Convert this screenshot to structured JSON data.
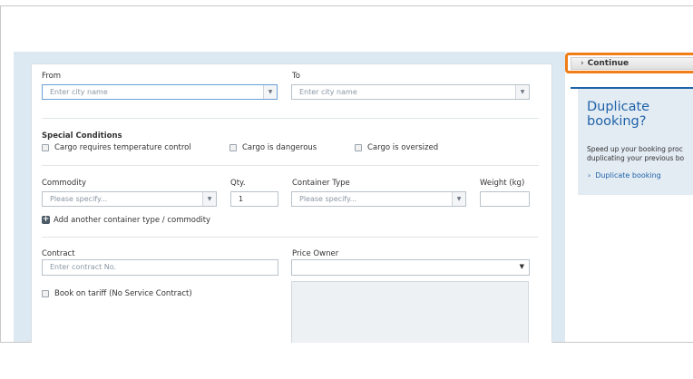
{
  "form": {
    "from": {
      "label": "From",
      "placeholder": "Enter city name"
    },
    "to": {
      "label": "To",
      "placeholder": "Enter city name"
    },
    "special_conditions": {
      "title": "Special Conditions",
      "options": [
        "Cargo requires temperature control",
        "Cargo is dangerous",
        "Cargo is oversized"
      ]
    },
    "commodity": {
      "label": "Commodity",
      "placeholder": "Please specify..."
    },
    "qty": {
      "label": "Qty.",
      "value": "1"
    },
    "container_type": {
      "label": "Container Type",
      "placeholder": "Please specify..."
    },
    "weight": {
      "label": "Weight (kg)",
      "value": ""
    },
    "add_another": "Add another container type / commodity",
    "contract": {
      "label": "Contract",
      "placeholder": "Enter contract No."
    },
    "price_owner": {
      "label": "Price Owner",
      "value": ""
    },
    "book_on_tariff": "Book on tariff (No Service Contract)"
  },
  "sidebar": {
    "continue_label": "Continue",
    "duplicate": {
      "title": "Duplicate booking?",
      "text_line1": "Speed up your booking proc",
      "text_line2": "duplicating your previous bo",
      "link": "Duplicate booking"
    }
  },
  "colors": {
    "accent": "#1f63a8",
    "highlight": "#f07d16",
    "band": "#dde9f2"
  }
}
